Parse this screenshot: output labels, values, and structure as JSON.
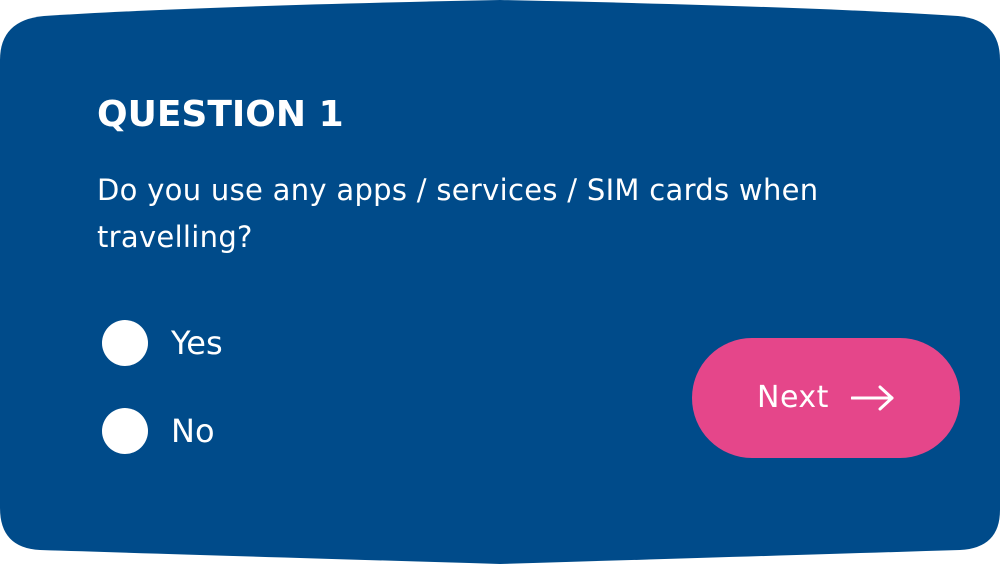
{
  "colors": {
    "card_background": "#004b8a",
    "accent": "#e5468a",
    "text": "#ffffff",
    "page_background": "#ffffff"
  },
  "question": {
    "label": "QUESTION 1",
    "text": "Do you use any apps / services / SIM cards when travelling?"
  },
  "options": [
    {
      "label": "Yes",
      "selected": false
    },
    {
      "label": "No",
      "selected": false
    }
  ],
  "next_button": {
    "label": "Next",
    "icon": "arrow-right-icon"
  }
}
